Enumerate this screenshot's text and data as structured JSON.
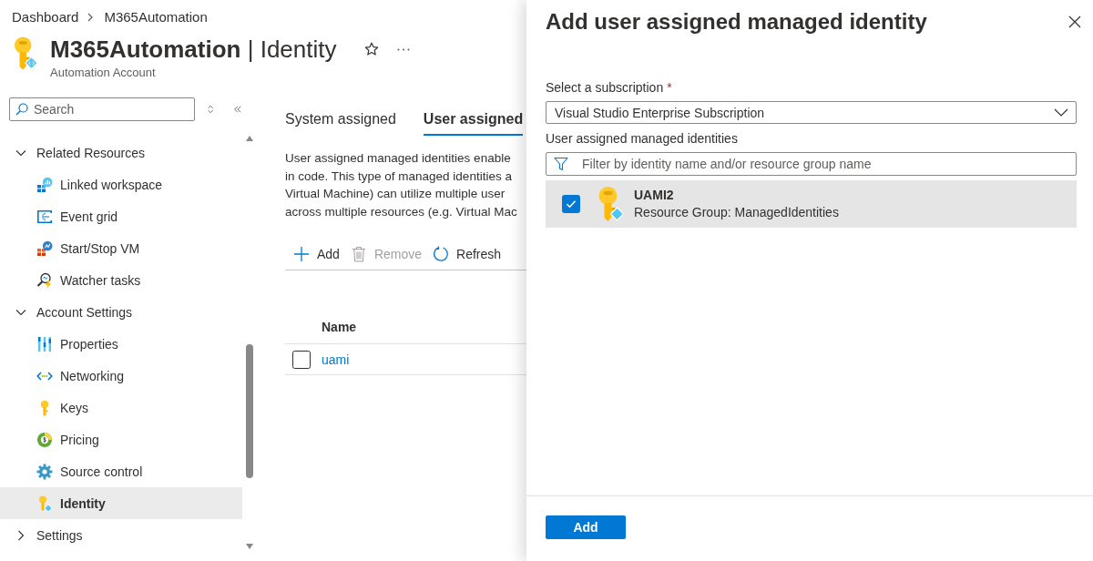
{
  "breadcrumb": [
    {
      "label": "Dashboard"
    },
    {
      "label": "M365Automation"
    }
  ],
  "header": {
    "title": "**M365Automation** | Identity",
    "subtitle": "Automation Account"
  },
  "sidebar": {
    "search": {
      "placeholder": "Search"
    },
    "items": [
      {
        "kind": "group",
        "label": "Related Resources",
        "expanded": true,
        "selected": false,
        "children": [
          {
            "kind": "page",
            "label": "Linked workspace",
            "selected": false
          },
          {
            "kind": "page",
            "label": "Event grid",
            "selected": false
          },
          {
            "kind": "page",
            "label": "Start/Stop VM",
            "selected": false
          },
          {
            "kind": "page",
            "label": "Watcher tasks",
            "selected": false
          }
        ]
      },
      {
        "kind": "group",
        "label": "Account Settings",
        "expanded": true,
        "selected": false,
        "children": [
          {
            "kind": "page",
            "label": "Properties",
            "selected": false
          },
          {
            "kind": "page",
            "label": "Networking",
            "selected": false
          },
          {
            "kind": "page",
            "label": "Keys",
            "selected": false
          },
          {
            "kind": "page",
            "label": "Pricing",
            "selected": false
          },
          {
            "kind": "page",
            "label": "Source control",
            "selected": false
          },
          {
            "kind": "page",
            "label": "Identity",
            "selected": true
          }
        ]
      },
      {
        "kind": "group",
        "label": "Settings",
        "expanded": false,
        "selected": false
      }
    ]
  },
  "tabs": [
    {
      "label": "System assigned",
      "selected": false
    },
    {
      "label": "User assigned",
      "selected": true
    }
  ],
  "description_lines": [
    "User assigned managed identities enable",
    "in code. This type of managed identities a",
    "Virtual Machine) can utilize multiple user",
    "across multiple resources (e.g. Virtual Mac"
  ],
  "toolbar": [
    {
      "label": "Add",
      "disabled": false
    },
    {
      "label": "Remove",
      "disabled": true
    },
    {
      "label": "Refresh",
      "disabled": false
    }
  ],
  "table": {
    "columns": [
      "Name"
    ],
    "rows": [
      {
        "name": "uami",
        "checked": false
      }
    ]
  },
  "panel": {
    "title": "Add user assigned managed identity",
    "subscription": {
      "label": "Select a subscription",
      "required_mark": "*",
      "value": "Visual Studio Enterprise Subscription"
    },
    "identities": {
      "label": "User assigned managed identities",
      "filter": {
        "placeholder": "Filter by identity name and/or resource group name"
      },
      "items": [
        {
          "name": "UAMI2",
          "resource_group": "Resource Group: ManagedIdentities",
          "checked": true,
          "selected": true
        }
      ]
    },
    "submit": {
      "label": "Add"
    }
  }
}
